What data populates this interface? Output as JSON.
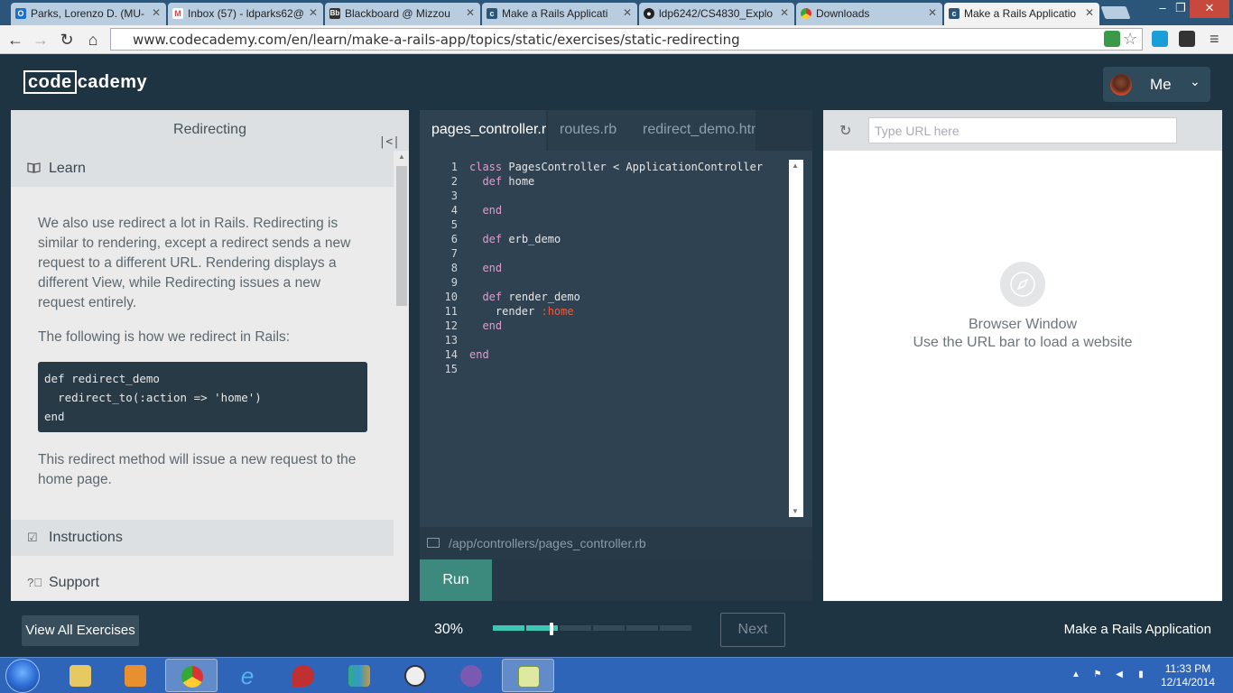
{
  "browser": {
    "tabs": [
      {
        "title": "Parks, Lorenzo D. (MU-",
        "icon": "outlook-icon"
      },
      {
        "title": "Inbox (57) - ldparks62@",
        "icon": "gmail-icon"
      },
      {
        "title": "Blackboard @ Mizzou",
        "icon": "blackboard-icon"
      },
      {
        "title": "Make a Rails Applicati",
        "icon": "codecademy-icon"
      },
      {
        "title": "ldp6242/CS4830_Explo",
        "icon": "github-icon"
      },
      {
        "title": "Downloads",
        "icon": "chrome-downloads-icon"
      },
      {
        "title": "Make a Rails Applicatio",
        "icon": "codecademy-icon",
        "active": true
      }
    ],
    "url": "www.codecademy.com/en/learn/make-a-rails-app/topics/static/exercises/static-redirecting"
  },
  "header": {
    "logo_box": "code",
    "logo_rest": "cademy",
    "user_label": "Me"
  },
  "lesson": {
    "title": "Redirecting",
    "learn_label": "Learn",
    "paragraphs": [
      "We also use redirect a lot in Rails. Redirecting is similar to rendering, except a redirect sends a new request to a different URL. Rendering displays a different View, while Redirecting issues a new request entirely.",
      "The following is how we redirect in Rails:"
    ],
    "snippet": "def redirect_demo\n  redirect_to(:action => 'home')\nend",
    "after_paragraph": "This redirect method will issue a new request to the home page.",
    "instructions_label": "Instructions",
    "support_label": "Support"
  },
  "editor": {
    "tabs": [
      "pages_controller.rb",
      "routes.rb",
      "redirect_demo.html.erb"
    ],
    "active_tab": 0,
    "lines": [
      "class PagesController < ApplicationController",
      "  def home",
      "",
      "  end",
      "",
      "  def erb_demo",
      "",
      "  end",
      "",
      "  def render_demo",
      "    render :home",
      "  end",
      "",
      "end",
      ""
    ],
    "file_path": "/app/controllers/pages_controller.rb",
    "run_label": "Run"
  },
  "browser_pane": {
    "url_placeholder": "Type URL here",
    "title": "Browser Window",
    "subtitle": "Use the URL bar to load a website"
  },
  "footer": {
    "view_all_label": "View All Exercises",
    "progress_label": "30%",
    "progress_fraction": 0.3,
    "next_label": "Next",
    "course_name": "Make a Rails Application"
  },
  "taskbar": {
    "time": "11:33 PM",
    "date": "12/14/2014",
    "apps": [
      "file-explorer-icon",
      "media-player-icon",
      "chrome-icon",
      "internet-explorer-icon",
      "pin-icon",
      "office-icon",
      "clock-app-icon",
      "github-desktop-icon",
      "notepad-icon"
    ]
  },
  "colors": {
    "accent": "#3cc8b4",
    "run": "#3b8a7d",
    "dark_bg": "#1f3442"
  }
}
